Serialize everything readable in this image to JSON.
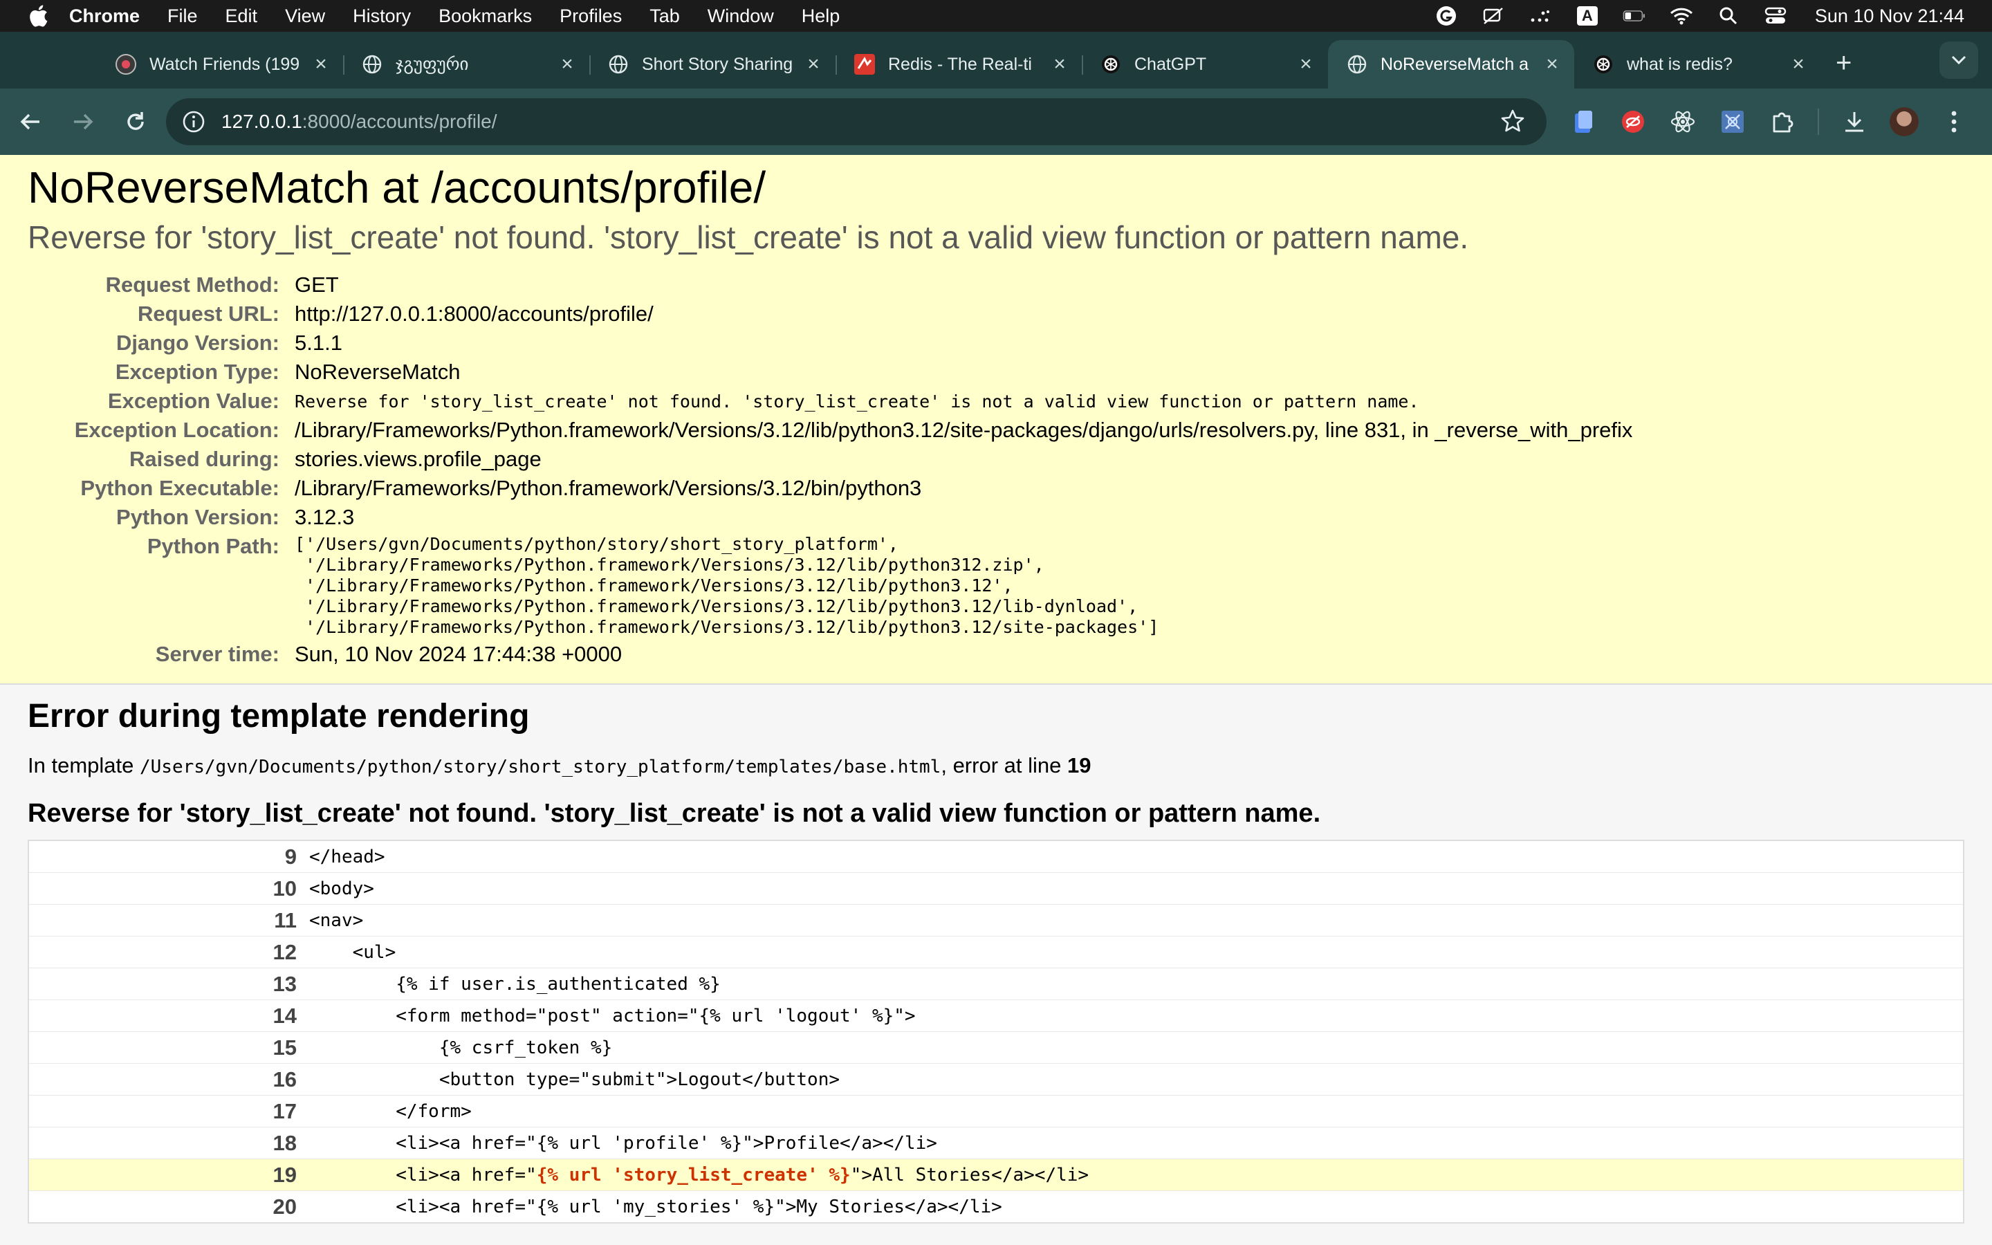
{
  "menubar": {
    "app": "Chrome",
    "items": [
      "File",
      "Edit",
      "View",
      "History",
      "Bookmarks",
      "Profiles",
      "Tab",
      "Window",
      "Help"
    ],
    "input_badge": "A",
    "clock": "Sun 10 Nov  21:44"
  },
  "tabs": [
    {
      "title": "Watch Friends (199",
      "icon": "friends-favicon",
      "active": false
    },
    {
      "title": "ჯგუფური",
      "icon": "globe-icon",
      "active": false
    },
    {
      "title": "Short Story Sharing",
      "icon": "globe-icon",
      "active": false
    },
    {
      "title": "Redis - The Real-ti",
      "icon": "redis-icon",
      "active": false
    },
    {
      "title": "ChatGPT",
      "icon": "chatgpt-icon",
      "active": false
    },
    {
      "title": "NoReverseMatch a",
      "icon": "globe-icon",
      "active": true
    },
    {
      "title": "what is redis?",
      "icon": "chatgpt-icon",
      "active": false
    }
  ],
  "address_bar": {
    "host": "127.0.0.1",
    "rest": ":8000/accounts/profile/"
  },
  "error": {
    "title": "NoReverseMatch at /accounts/profile/",
    "subtitle": "Reverse for 'story_list_create' not found. 'story_list_create' is not a valid view function or pattern name.",
    "meta": [
      {
        "label": "Request Method:",
        "value": "GET"
      },
      {
        "label": "Request URL:",
        "value": "http://127.0.0.1:8000/accounts/profile/"
      },
      {
        "label": "Django Version:",
        "value": "5.1.1"
      },
      {
        "label": "Exception Type:",
        "value": "NoReverseMatch"
      },
      {
        "label": "Exception Value:",
        "value": "Reverse for 'story_list_create' not found. 'story_list_create' is not a valid view function or pattern name.",
        "mono": true
      },
      {
        "label": "Exception Location:",
        "value": "/Library/Frameworks/Python.framework/Versions/3.12/lib/python3.12/site-packages/django/urls/resolvers.py, line 831, in _reverse_with_prefix"
      },
      {
        "label": "Raised during:",
        "value": "stories.views.profile_page"
      },
      {
        "label": "Python Executable:",
        "value": "/Library/Frameworks/Python.framework/Versions/3.12/bin/python3"
      },
      {
        "label": "Python Version:",
        "value": "3.12.3"
      },
      {
        "label": "Python Path:",
        "value": "['/Users/gvn/Documents/python/story/short_story_platform',\n '/Library/Frameworks/Python.framework/Versions/3.12/lib/python312.zip',\n '/Library/Frameworks/Python.framework/Versions/3.12/lib/python3.12',\n '/Library/Frameworks/Python.framework/Versions/3.12/lib/python3.12/lib-dynload',\n '/Library/Frameworks/Python.framework/Versions/3.12/lib/python3.12/site-packages']",
        "pre": true
      },
      {
        "label": "Server time:",
        "value": "Sun, 10 Nov 2024 17:44:38 +0000"
      }
    ]
  },
  "template_error": {
    "heading": "Error during template rendering",
    "in_template_prefix": "In template ",
    "template_path": "/Users/gvn/Documents/python/story/short_story_platform/templates/base.html",
    "error_at_line_text": ", error at line ",
    "error_line": "19",
    "message": "Reverse for 'story_list_create' not found. 'story_list_create' is not a valid view function or pattern name.",
    "source_lines": [
      {
        "no": "9",
        "code": "</head>"
      },
      {
        "no": "10",
        "code": "<body>"
      },
      {
        "no": "11",
        "code": "<nav>"
      },
      {
        "no": "12",
        "code": "    <ul>"
      },
      {
        "no": "13",
        "code": "        {% if user.is_authenticated %}"
      },
      {
        "no": "14",
        "code": "        <form method=\"post\" action=\"{% url 'logout' %}\">"
      },
      {
        "no": "15",
        "code": "            {% csrf_token %}"
      },
      {
        "no": "16",
        "code": "            <button type=\"submit\">Logout</button>"
      },
      {
        "no": "17",
        "code": "        </form>"
      },
      {
        "no": "18",
        "code": "        <li><a href=\"{% url 'profile' %}\">Profile</a></li>"
      },
      {
        "no": "19",
        "code_before": "        <li><a href=\"",
        "code_err": "{% url 'story_list_create' %}",
        "code_after": "\">All Stories</a></li>",
        "highlight": true
      },
      {
        "no": "20",
        "code": "        <li><a href=\"{% url 'my_stories' %}\">My Stories</a></li>"
      }
    ]
  },
  "colors": {
    "menubar": "#1b1b1b",
    "tabstrip": "#1f3a3a",
    "toolbar": "#2d5051",
    "summary_bg": "#ffffcc",
    "error_token": "#cc3300"
  }
}
